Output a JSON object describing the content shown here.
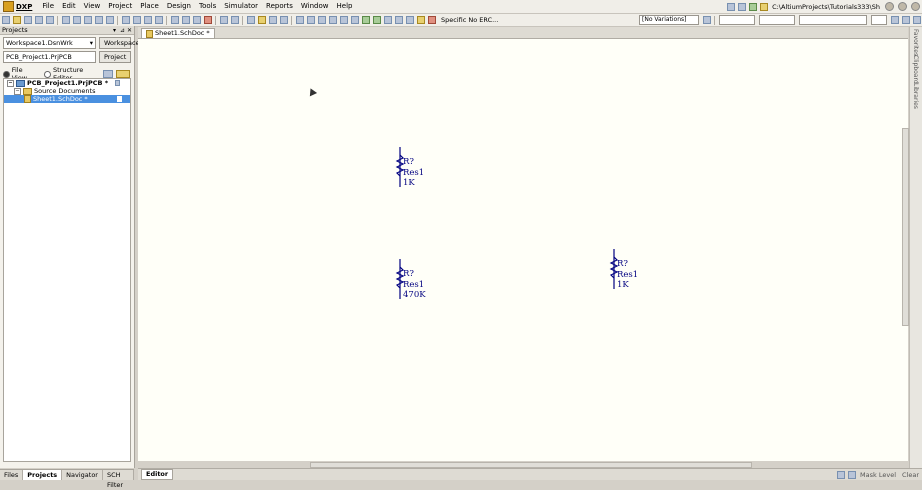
{
  "app": {
    "logo": "DXP"
  },
  "menu": [
    "File",
    "Edit",
    "View",
    "Project",
    "Place",
    "Design",
    "Tools",
    "Simulator",
    "Reports",
    "Window",
    "Help"
  ],
  "path": "C:\\AltiumProjects\\Tutorials333\\Sh",
  "toolbar": {
    "erc": "Specific No ERC...",
    "variations": "[No Variations]"
  },
  "panel": {
    "title": "Projects",
    "workspace": "Workspace1.DsnWrk",
    "workspace_btn": "Workspace",
    "project": "PCB_Project1.PrjPCB",
    "project_btn": "Project",
    "file_view": "File View",
    "structure_editor": "Structure Editor",
    "tree": {
      "project": "PCB_Project1.PrjPCB *",
      "folder": "Source Documents",
      "doc": "Sheet1.SchDoc *"
    },
    "tabs": [
      "Files",
      "Projects",
      "Navigator",
      "SCH Filter"
    ]
  },
  "doc_tab": "Sheet1.SchDoc *",
  "side_tabs": [
    "Favorites",
    "Clipboard",
    "Libraries"
  ],
  "status": {
    "editor_tab": "Editor",
    "mask_level": "Mask Level",
    "clear": "Clear"
  },
  "components": [
    {
      "designator": "R?",
      "comment": "Res1",
      "value": "1K"
    },
    {
      "designator": "R?",
      "comment": "Res1",
      "value": "470K"
    },
    {
      "designator": "R?",
      "comment": "Res1",
      "value": "1K"
    }
  ],
  "colors": {
    "wire": "#000080",
    "canvas": "#fffff8",
    "selection": "#4a90e0"
  }
}
